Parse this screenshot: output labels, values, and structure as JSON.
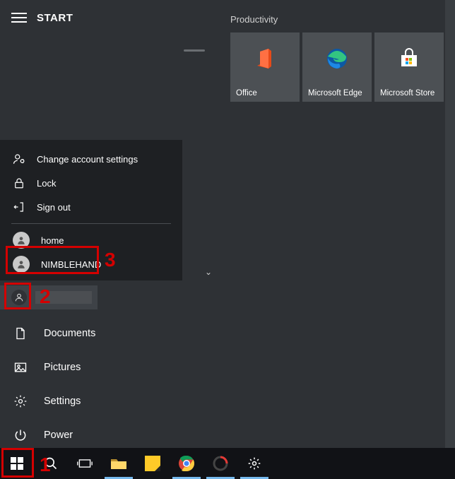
{
  "header": {
    "title": "START"
  },
  "tile_group": {
    "heading": "Productivity"
  },
  "tiles": [
    {
      "label": "Office"
    },
    {
      "label": "Microsoft Edge"
    },
    {
      "label": "Microsoft Store"
    }
  ],
  "account_menu": {
    "change": "Change account settings",
    "lock": "Lock",
    "signout": "Sign out",
    "users": [
      {
        "name": "home"
      },
      {
        "name": "NIMBLEHAND"
      }
    ]
  },
  "rail": {
    "documents": "Documents",
    "pictures": "Pictures",
    "settings": "Settings",
    "power": "Power"
  },
  "annotations": {
    "n1": "1",
    "n2": "2",
    "n3": "3"
  }
}
